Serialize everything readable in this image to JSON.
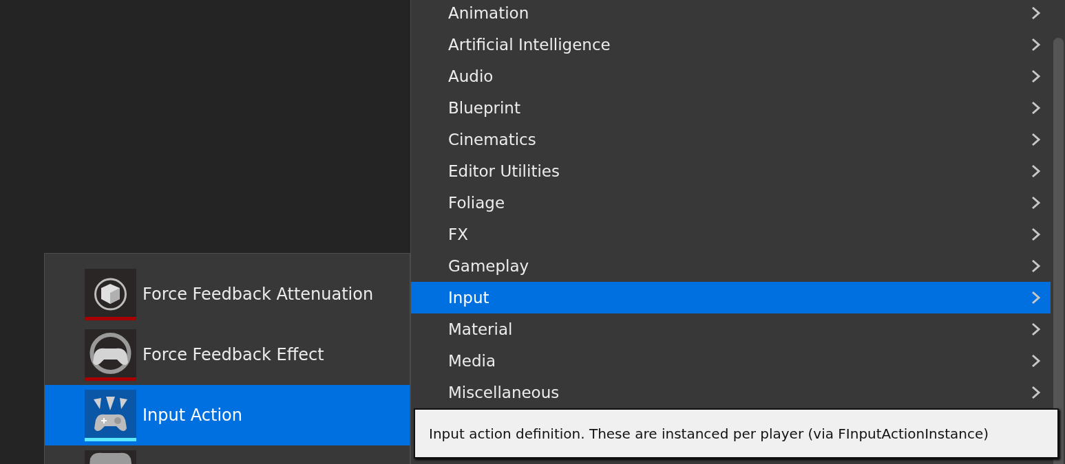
{
  "categories": [
    {
      "label": "Animation",
      "selected": false
    },
    {
      "label": "Artificial Intelligence",
      "selected": false
    },
    {
      "label": "Audio",
      "selected": false
    },
    {
      "label": "Blueprint",
      "selected": false
    },
    {
      "label": "Cinematics",
      "selected": false
    },
    {
      "label": "Editor Utilities",
      "selected": false
    },
    {
      "label": "Foliage",
      "selected": false
    },
    {
      "label": "FX",
      "selected": false
    },
    {
      "label": "Gameplay",
      "selected": false
    },
    {
      "label": "Input",
      "selected": true
    },
    {
      "label": "Material",
      "selected": false
    },
    {
      "label": "Media",
      "selected": false
    },
    {
      "label": "Miscellaneous",
      "selected": false
    }
  ],
  "submenu": {
    "items": [
      {
        "label": "Force Feedback Attenuation",
        "kind": "attenuation",
        "selected": false,
        "color": "#a80000"
      },
      {
        "label": "Force Feedback Effect",
        "kind": "effect",
        "selected": false,
        "color": "#a80000"
      },
      {
        "label": "Input Action",
        "kind": "action",
        "selected": true,
        "color": "#5ae8ff"
      },
      {
        "kind": "mapping",
        "selected": false
      }
    ]
  },
  "tooltip": {
    "text": "Input action definition. These are instanced per player (via FInputActionInstance)"
  }
}
